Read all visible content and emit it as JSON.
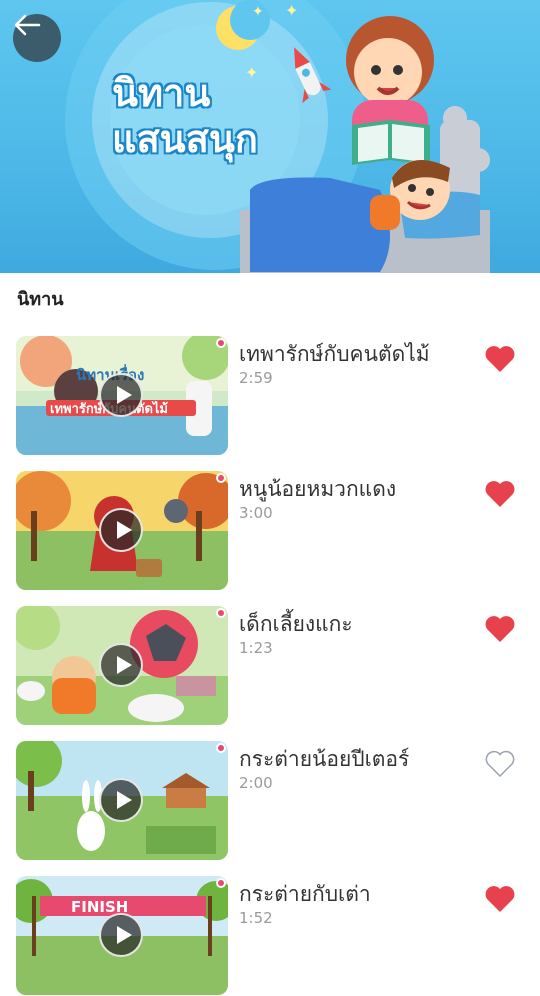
{
  "header": {
    "back_label": "back",
    "banner_title_line1": "นิทาน",
    "banner_title_line2": "แสนสนุก"
  },
  "section": {
    "heading": "นิทาน"
  },
  "stories": [
    {
      "title": "เทพารักษ์กับคนตัดไม้",
      "duration": "2:59",
      "favorited": true,
      "thumb_caption_1": "นิทานเรื่อง",
      "thumb_caption_2": "เทพารักษ์กับคนตัดไม้"
    },
    {
      "title": "หนูน้อยหมวกแดง",
      "duration": "3:00",
      "favorited": true
    },
    {
      "title": "เด็กเลี้ยงแกะ",
      "duration": "1:23",
      "favorited": true
    },
    {
      "title": "กระต่ายน้อยปีเตอร์",
      "duration": "2:00",
      "favorited": false
    },
    {
      "title": "กระต่ายกับเต่า",
      "duration": "1:52",
      "favorited": true,
      "thumb_caption_1": "FINISH"
    }
  ],
  "colors": {
    "heart_filled": "#e8414e",
    "heart_outline": "#9aa3ad",
    "banner": "#4db8e8",
    "back_button": "#3b5d6b"
  }
}
